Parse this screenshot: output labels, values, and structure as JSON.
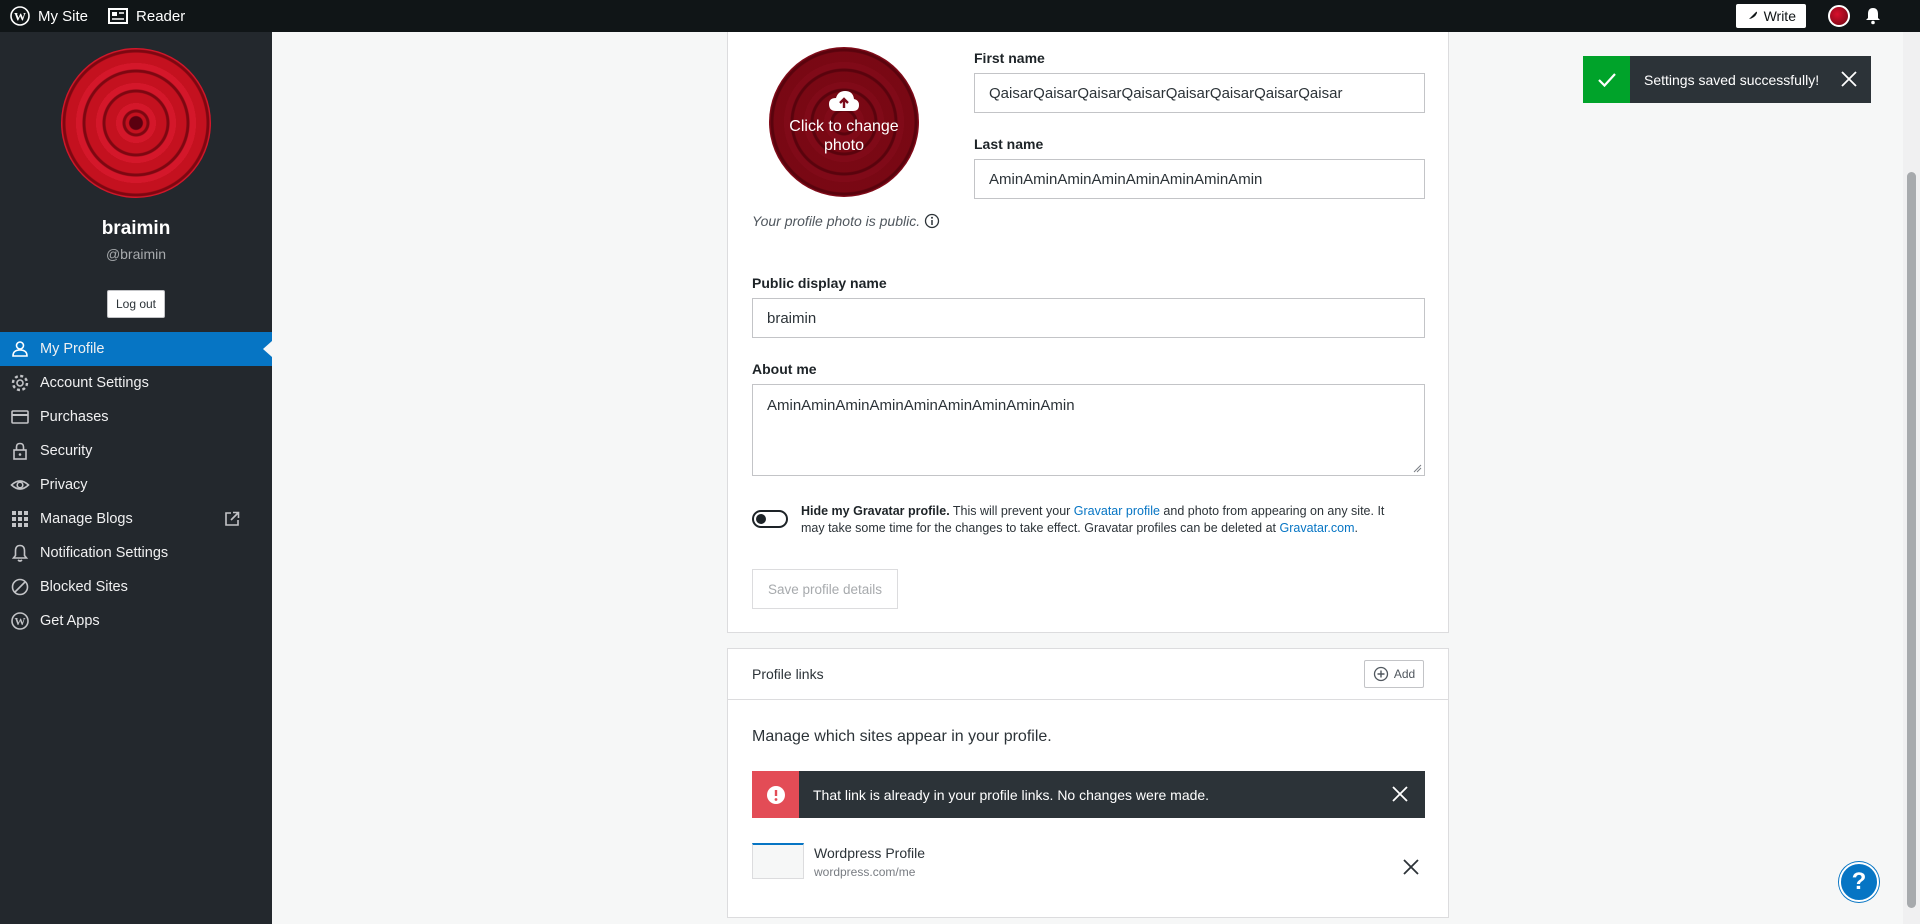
{
  "masterbar": {
    "my_site": "My Site",
    "reader": "Reader",
    "write": "Write"
  },
  "sidebar": {
    "name": "braimin",
    "handle": "@braimin",
    "logout": "Log out",
    "items": [
      {
        "label": "My Profile",
        "icon": "person-icon"
      },
      {
        "label": "Account Settings",
        "icon": "gear-icon"
      },
      {
        "label": "Purchases",
        "icon": "credit-card-icon"
      },
      {
        "label": "Security",
        "icon": "lock-icon"
      },
      {
        "label": "Privacy",
        "icon": "eye-icon"
      },
      {
        "label": "Manage Blogs",
        "icon": "grid-icon"
      },
      {
        "label": "Notification Settings",
        "icon": "bell-icon"
      },
      {
        "label": "Blocked Sites",
        "icon": "block-icon"
      },
      {
        "label": "Get Apps",
        "icon": "wordpress-icon"
      }
    ]
  },
  "profile": {
    "change_photo": "Click to change photo",
    "photo_note": "Your profile photo is public.",
    "first_name_label": "First name",
    "first_name": "QaisarQaisarQaisarQaisarQaisarQaisarQaisarQaisar",
    "last_name_label": "Last name",
    "last_name": "AminAminAminAminAminAminAminAmin",
    "display_name_label": "Public display name",
    "display_name": "braimin",
    "about_label": "About me",
    "about": "AminAminAminAminAminAminAminAminAmin",
    "hide_bold": "Hide my Gravatar profile.",
    "hide_text1": " This will prevent your ",
    "hide_link1": "Gravatar profile",
    "hide_text2": " and photo from appearing on any site. It may take some time for the changes to take effect. Gravatar profiles can be deleted at ",
    "hide_link2": "Gravatar.com",
    "hide_text3": ".",
    "save": "Save profile details"
  },
  "links": {
    "title": "Profile links",
    "add": "Add",
    "manage_text": "Manage which sites appear in your profile.",
    "error": "That link is already in your profile links. No changes were made.",
    "items": [
      {
        "name": "Wordpress Profile",
        "url": "wordpress.com/me"
      }
    ]
  },
  "toast": {
    "text": "Settings saved successfully!"
  },
  "help": {
    "label": "?"
  },
  "colors": {
    "accent": "#0675c4",
    "success": "#00a32a",
    "error": "#e34c56",
    "sidebar": "#23282d"
  }
}
